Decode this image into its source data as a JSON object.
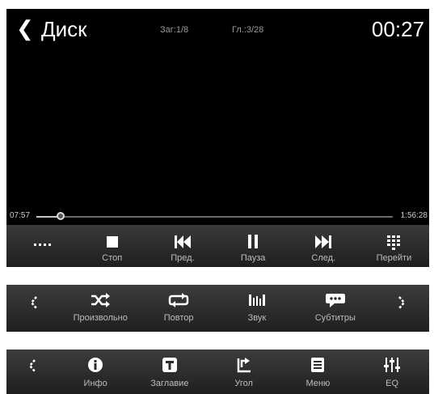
{
  "header": {
    "title": "Диск",
    "chapter_title": "Заг:1/8",
    "chapter_number": "Гл.:3/28",
    "clock": "00:27"
  },
  "playback": {
    "elapsed": "07:57",
    "total": "1:56:28",
    "progress_fraction": 0.068
  },
  "controls": {
    "more_label": "",
    "stop_label": "Стоп",
    "prev_label": "Пред.",
    "pause_label": "Пауза",
    "next_label": "След.",
    "goto_label": "Перейти"
  },
  "bar2": {
    "shuffle_label": "Произвольно",
    "repeat_label": "Повтор",
    "sound_label": "Звук",
    "subtitles_label": "Субтитры"
  },
  "bar3": {
    "info_label": "Инфо",
    "title_label": "Заглавие",
    "angle_label": "Угол",
    "menu_label": "Меню",
    "eq_label": "EQ"
  },
  "colors": {
    "bar_top": "#3c3c3c",
    "bar_bottom": "#1f1f1f",
    "icon": "#ffffff",
    "label": "#bdbdbd"
  }
}
